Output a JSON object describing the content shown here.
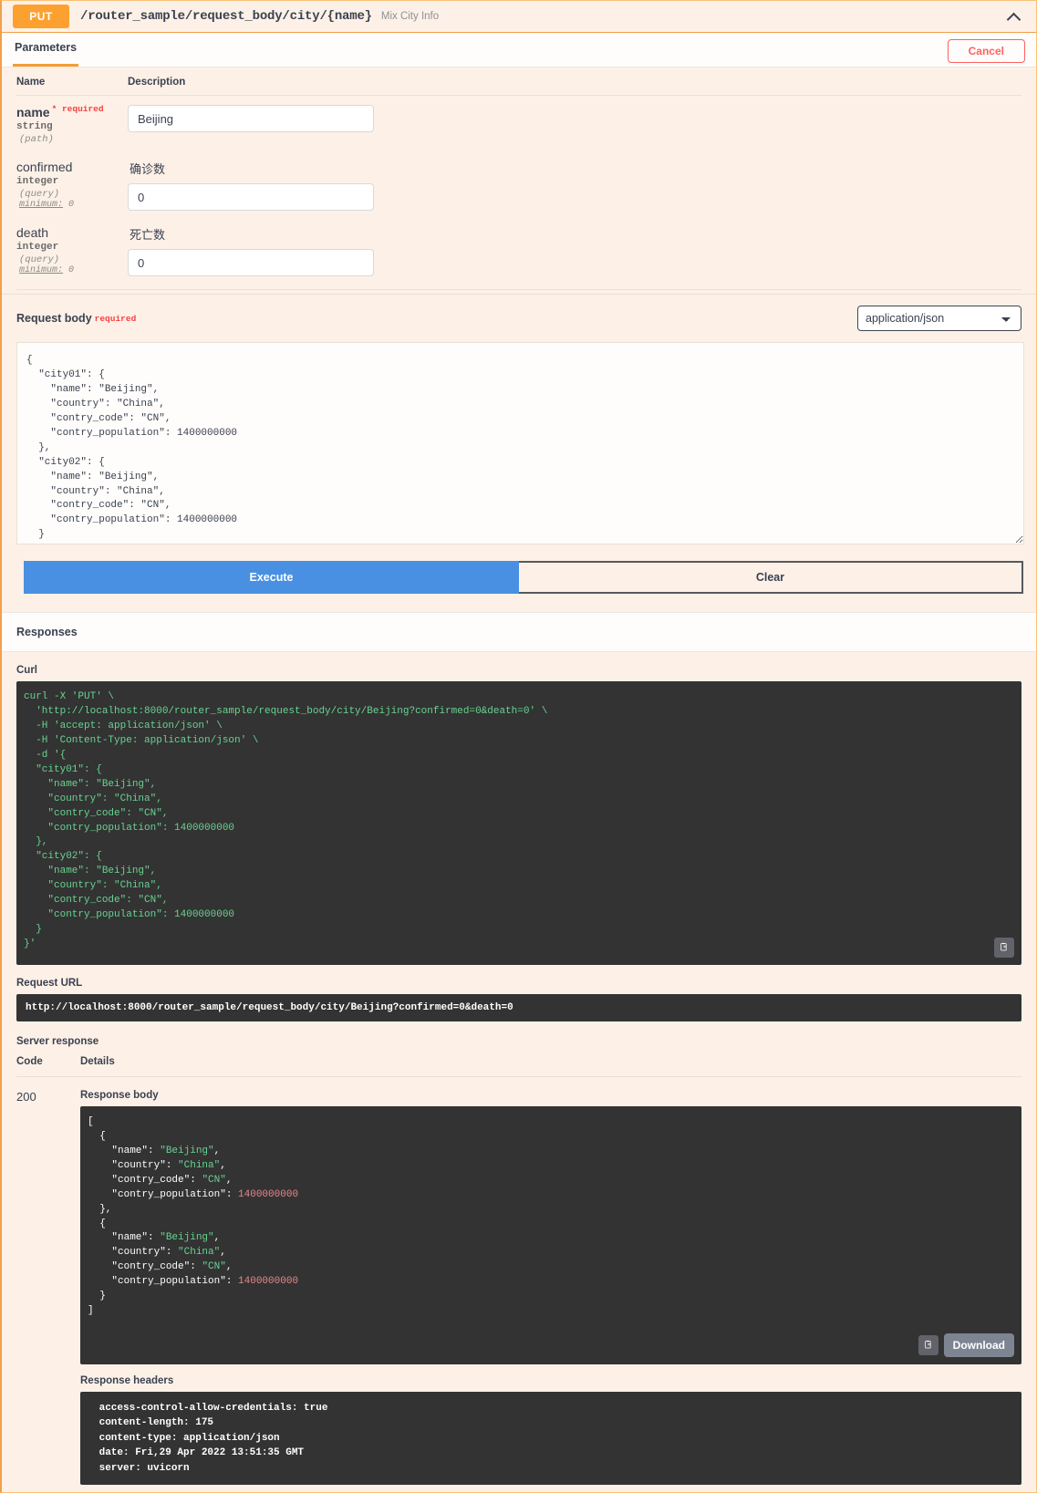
{
  "operation": {
    "method": "PUT",
    "path": "/router_sample/request_body/city/{name}",
    "summary": "Mix City Info",
    "collapse_icon": "chevron-up-icon"
  },
  "tabs": {
    "parameters_label": "Parameters",
    "cancel_label": "Cancel"
  },
  "params_table": {
    "headers": {
      "name": "Name",
      "description": "Description"
    },
    "rows": [
      {
        "name": "name",
        "required_label": "* required",
        "type": "string",
        "in": "(path)",
        "minimum": "",
        "description": "",
        "value": "Beijing",
        "is_required": true
      },
      {
        "name": "confirmed",
        "required_label": "",
        "type": "integer",
        "in": "(query)",
        "minimum_key": "minimum:",
        "minimum_value": "0",
        "description": "确诊数",
        "value": "0",
        "is_required": false
      },
      {
        "name": "death",
        "required_label": "",
        "type": "integer",
        "in": "(query)",
        "minimum_key": "minimum:",
        "minimum_value": "0",
        "description": "死亡数",
        "value": "0",
        "is_required": false
      }
    ]
  },
  "request_body": {
    "title": "Request body",
    "required_label": "required",
    "media_type_selected": "application/json",
    "media_type_options": [
      "application/json"
    ],
    "dropdown_icon": "chevron-down-icon",
    "editor_value": "{\n  \"city01\": {\n    \"name\": \"Beijing\",\n    \"country\": \"China\",\n    \"contry_code\": \"CN\",\n    \"contry_population\": 1400000000\n  },\n  \"city02\": {\n    \"name\": \"Beijing\",\n    \"country\": \"China\",\n    \"contry_code\": \"CN\",\n    \"contry_population\": 1400000000\n  }\n}"
  },
  "actions": {
    "execute_label": "Execute",
    "clear_label": "Clear",
    "execute_color": "#4990e2"
  },
  "responses": {
    "section_title": "Responses",
    "curl_label": "Curl",
    "curl_text": "curl -X 'PUT' \\\n  'http://localhost:8000/router_sample/request_body/city/Beijing?confirmed=0&death=0' \\\n  -H 'accept: application/json' \\\n  -H 'Content-Type: application/json' \\\n  -d '{\n  \"city01\": {\n    \"name\": \"Beijing\",\n    \"country\": \"China\",\n    \"contry_code\": \"CN\",\n    \"contry_population\": 1400000000\n  },\n  \"city02\": {\n    \"name\": \"Beijing\",\n    \"country\": \"China\",\n    \"contry_code\": \"CN\",\n    \"contry_population\": 1400000000\n  }\n}'",
    "copy_curl_icon": "copy-icon",
    "request_url_label": "Request URL",
    "request_url": "http://localhost:8000/router_sample/request_body/city/Beijing?confirmed=0&death=0",
    "server_response_label": "Server response",
    "table_headers": {
      "code": "Code",
      "details": "Details"
    },
    "code": "200",
    "response_body_label": "Response body",
    "response_body_text": "[\n  {\n    \"name\": \"Beijing\",\n    \"country\": \"China\",\n    \"contry_code\": \"CN\",\n    \"contry_population\": 1400000000\n  },\n  {\n    \"name\": \"Beijing\",\n    \"country\": \"China\",\n    \"contry_code\": \"CN\",\n    \"contry_population\": 1400000000\n  }\n]",
    "copy_body_icon": "copy-icon",
    "download_label": "Download",
    "response_headers_label": "Response headers",
    "response_headers_text": " access-control-allow-credentials: true \n content-length: 175 \n content-type: application/json \n date: Fri,29 Apr 2022 13:51:35 GMT \n server: uvicorn "
  },
  "colors": {
    "method_put": "#fca130",
    "panel_bg": "#fdf1e7",
    "border": "#f0a04b",
    "required_red": "#f93e3e",
    "code_bg": "#333333",
    "string_green": "#68d391",
    "number_red": "#e8868b"
  }
}
